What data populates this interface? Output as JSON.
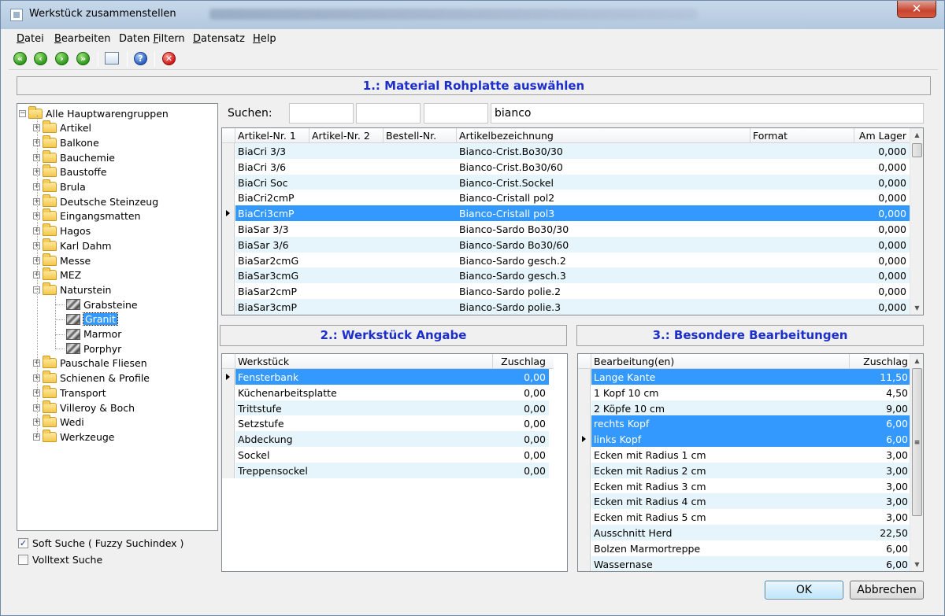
{
  "window": {
    "title": "Werkstück zusammenstellen",
    "close_glyph": "✕"
  },
  "menu": [
    {
      "pre": "",
      "u": "D",
      "post": "atei"
    },
    {
      "pre": "",
      "u": "B",
      "post": "earbeiten"
    },
    {
      "pre": "Daten ",
      "u": "F",
      "post": "iltern"
    },
    {
      "pre": "",
      "u": "D",
      "post": "atensatz"
    },
    {
      "pre": "",
      "u": "H",
      "post": "elp"
    }
  ],
  "toolbar": {
    "icons": [
      "first-icon",
      "prev-icon",
      "next-icon",
      "last-icon",
      "screen-icon",
      "help-icon",
      "cancel-icon"
    ],
    "glyphs": {
      "first": "«",
      "prev": "‹",
      "next": "›",
      "last": "»",
      "help": "?",
      "cancel": "✕"
    }
  },
  "sections": {
    "s1": "1.: Material Rohplatte auswählen",
    "s2": "2.: Werkstück Angabe",
    "s3": "3.: Besondere Bearbeitungen"
  },
  "tree": {
    "root": "Alle Hauptwarengruppen",
    "groups": [
      "Artikel",
      "Balkone",
      "Bauchemie",
      "Baustoffe",
      "Brula",
      "Deutsche Steinzeug",
      "Eingangsmatten",
      "Hagos",
      "Karl Dahm",
      "Messe",
      "MEZ",
      "Naturstein"
    ],
    "naturstein_children": [
      "Grabsteine",
      "Granit",
      "Marmor",
      "Porphyr"
    ],
    "selected_child": "Granit",
    "groups_after": [
      "Pauschale Fliesen",
      "Schienen & Profile",
      "Transport",
      "Villeroy & Boch",
      "Wedi",
      "Werkzeuge"
    ],
    "expand_plus": "+",
    "expand_minus": "−"
  },
  "options": {
    "soft_search": {
      "label": "Soft Suche ( Fuzzy Suchindex )",
      "checked": true,
      "mark": "✓"
    },
    "volltext": {
      "label": "Volltext Suche",
      "checked": false
    }
  },
  "search": {
    "label": "Suchen:",
    "fields": [
      "",
      "",
      "",
      "bianco"
    ]
  },
  "material_grid": {
    "columns": [
      "Artikel-Nr. 1",
      "Artikel-Nr. 2",
      "Bestell-Nr.",
      "Artikelbezeichnung",
      "Format",
      "Am Lager"
    ],
    "rows": [
      [
        "BiaCri 3/3",
        "",
        "",
        "Bianco-Crist.Bo30/30",
        "",
        "0,000"
      ],
      [
        "BiaCri 3/6",
        "",
        "",
        "Bianco-Crist.Bo30/60",
        "",
        "0,000"
      ],
      [
        "BiaCri Soc",
        "",
        "",
        "Bianco-Crist.Sockel",
        "",
        "0,000"
      ],
      [
        "BiaCri2cmP",
        "",
        "",
        "Bianco-Cristall pol2",
        "",
        "0,000"
      ],
      [
        "BiaCri3cmP",
        "",
        "",
        "Bianco-Cristall pol3",
        "",
        "0,000"
      ],
      [
        "BiaSar 3/3",
        "",
        "",
        "Bianco-Sardo Bo30/30",
        "",
        "0,000"
      ],
      [
        "BiaSar 3/6",
        "",
        "",
        "Bianco-Sardo Bo30/60",
        "",
        "0,000"
      ],
      [
        "BiaSar2cmG",
        "",
        "",
        "Bianco-Sardo gesch.2",
        "",
        "0,000"
      ],
      [
        "BiaSar3cmG",
        "",
        "",
        "Bianco-Sardo gesch.3",
        "",
        "0,000"
      ],
      [
        "BiaSar2cmP",
        "",
        "",
        "Bianco-Sardo polie.2",
        "",
        "0,000"
      ],
      [
        "BiaSar3cmP",
        "",
        "",
        "Bianco-Sardo polie.3",
        "",
        "0,000"
      ]
    ],
    "selected_row": 4
  },
  "werkstueck_grid": {
    "columns": [
      "Werkstück",
      "Zuschlag"
    ],
    "rows": [
      [
        "Fensterbank",
        "0,00"
      ],
      [
        "Küchenarbeitsplatte",
        "0,00"
      ],
      [
        "Trittstufe",
        "0,00"
      ],
      [
        "Setzstufe",
        "0,00"
      ],
      [
        "Abdeckung",
        "0,00"
      ],
      [
        "Sockel",
        "0,00"
      ],
      [
        "Treppensockel",
        "0,00"
      ]
    ],
    "selected_rows": [
      0
    ],
    "current_row": 0
  },
  "bearbeitung_grid": {
    "columns": [
      "Bearbeitung(en)",
      "Zuschlag"
    ],
    "rows": [
      [
        "Lange Kante",
        "11,50"
      ],
      [
        "1 Kopf 10 cm",
        "4,50"
      ],
      [
        "2 Köpfe 10 cm",
        "9,00"
      ],
      [
        "rechts Kopf",
        "6,00"
      ],
      [
        "links Kopf",
        "6,00"
      ],
      [
        "Ecken mit Radius 1 cm",
        "3,00"
      ],
      [
        "Ecken mit Radius 2 cm",
        "3,00"
      ],
      [
        "Ecken mit Radius 3 cm",
        "3,00"
      ],
      [
        "Ecken mit Radius 4 cm",
        "3,00"
      ],
      [
        "Ecken mit Radius 5 cm",
        "3,00"
      ],
      [
        "Ausschnitt Herd",
        "22,50"
      ],
      [
        "Bolzen Marmortreppe",
        "6,00"
      ],
      [
        "Wassernase",
        "6,00"
      ]
    ],
    "selected_rows": [
      0,
      3,
      4
    ],
    "current_row": 4
  },
  "scroll_glyphs": {
    "up": "▲",
    "down": "▼",
    "grip": "≡"
  },
  "buttons": {
    "ok": "OK",
    "cancel": "Abbrechen"
  }
}
